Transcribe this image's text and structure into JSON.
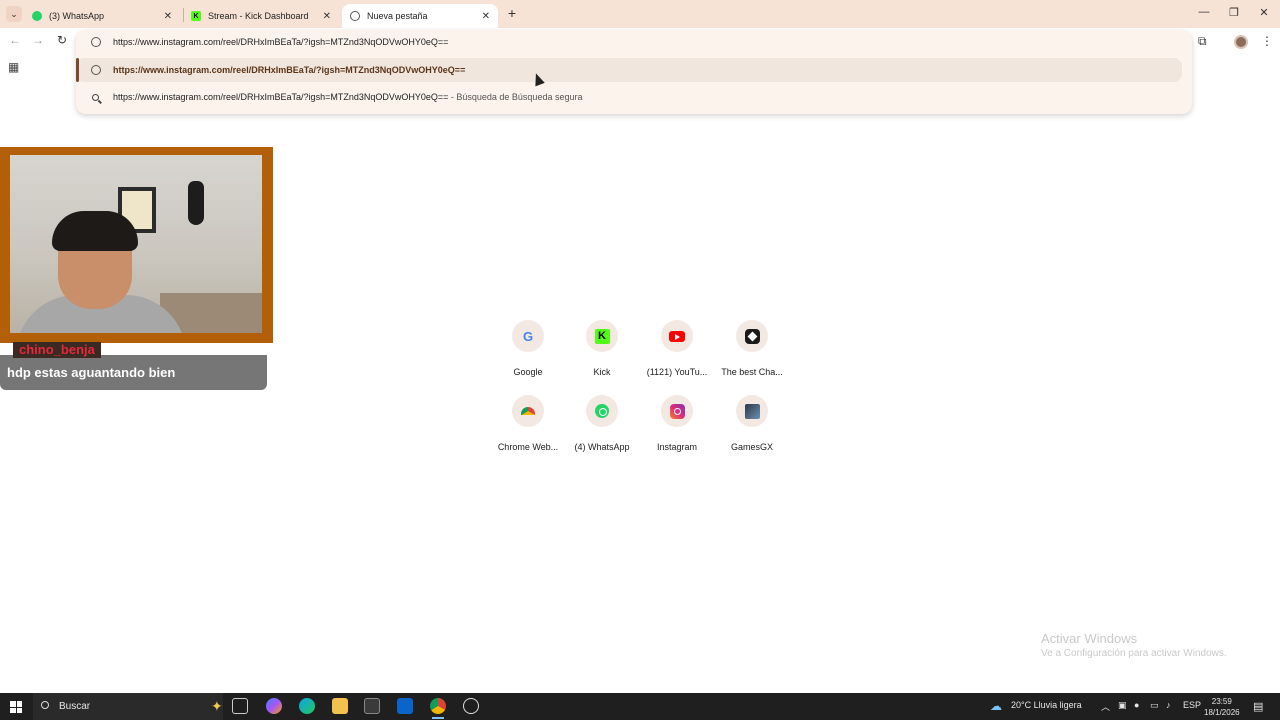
{
  "tabs": [
    {
      "title": "(3) WhatsApp",
      "icon": "whatsapp-icon",
      "active": false
    },
    {
      "title": "Stream - Kick Dashboard",
      "icon": "kick-icon",
      "active": false
    },
    {
      "title": "Nueva pestaña",
      "icon": "globe-icon",
      "active": true
    }
  ],
  "omnibox": {
    "input_value": "https://www.instagram.com/reel/DRHxImBEaTa/?igsh=MTZnd3NqODVwOHY0eQ==",
    "suggestions": [
      {
        "text": "https://www.instagram.com/reel/DRHxImBEaTa/?igsh=MTZnd3NqODVwOHY0eQ==",
        "sub": "",
        "icon": "globe-icon",
        "selected": true
      },
      {
        "text": "https://www.instagram.com/reel/DRHxImBEaTa/?igsh=MTZnd3NqODVwOHY0eQ==",
        "sub": " - Búsqueda de Búsqueda segura",
        "icon": "search-icon",
        "selected": false
      }
    ]
  },
  "stream": {
    "chat_user": "chino_benja",
    "chat_message": "hdp estas aguantando bien"
  },
  "shortcuts": [
    {
      "label": "Google",
      "icon": "google-icon"
    },
    {
      "label": "Kick",
      "icon": "kick-icon"
    },
    {
      "label": "(1121) YouTu...",
      "icon": "youtube-icon"
    },
    {
      "label": "The best Cha...",
      "icon": "chess-icon"
    },
    {
      "label": "Chrome Web...",
      "icon": "chrome-web-store-icon"
    },
    {
      "label": "(4) WhatsApp",
      "icon": "whatsapp-icon"
    },
    {
      "label": "Instagram",
      "icon": "instagram-icon"
    },
    {
      "label": "GamesGX",
      "icon": "gamesgx-icon"
    }
  ],
  "watermark": {
    "line1": "Activar Windows",
    "line2": "Ve a Configuración para activar Windows."
  },
  "taskbar": {
    "search_label": "Buscar",
    "weather": "20°C  Lluvia ligera",
    "language": "ESP",
    "time": "23:59",
    "date": "18/1/2026"
  }
}
